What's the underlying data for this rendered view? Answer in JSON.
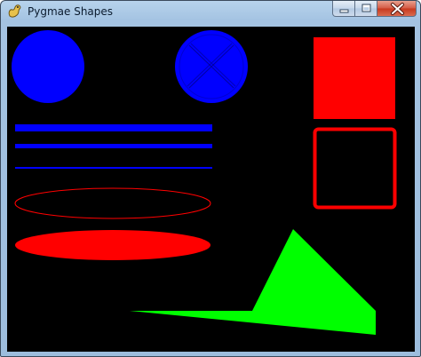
{
  "window": {
    "title": "Pygmae Shapes",
    "app_icon": "pygame-snake-icon",
    "controls": {
      "minimize_icon": "minimize-icon",
      "maximize_icon": "maximize-icon",
      "close_icon": "close-icon"
    }
  },
  "canvas": {
    "background": "#000000",
    "colors": {
      "blue": "#0000ff",
      "red": "#ff0000",
      "green": "#00ff00"
    }
  }
}
